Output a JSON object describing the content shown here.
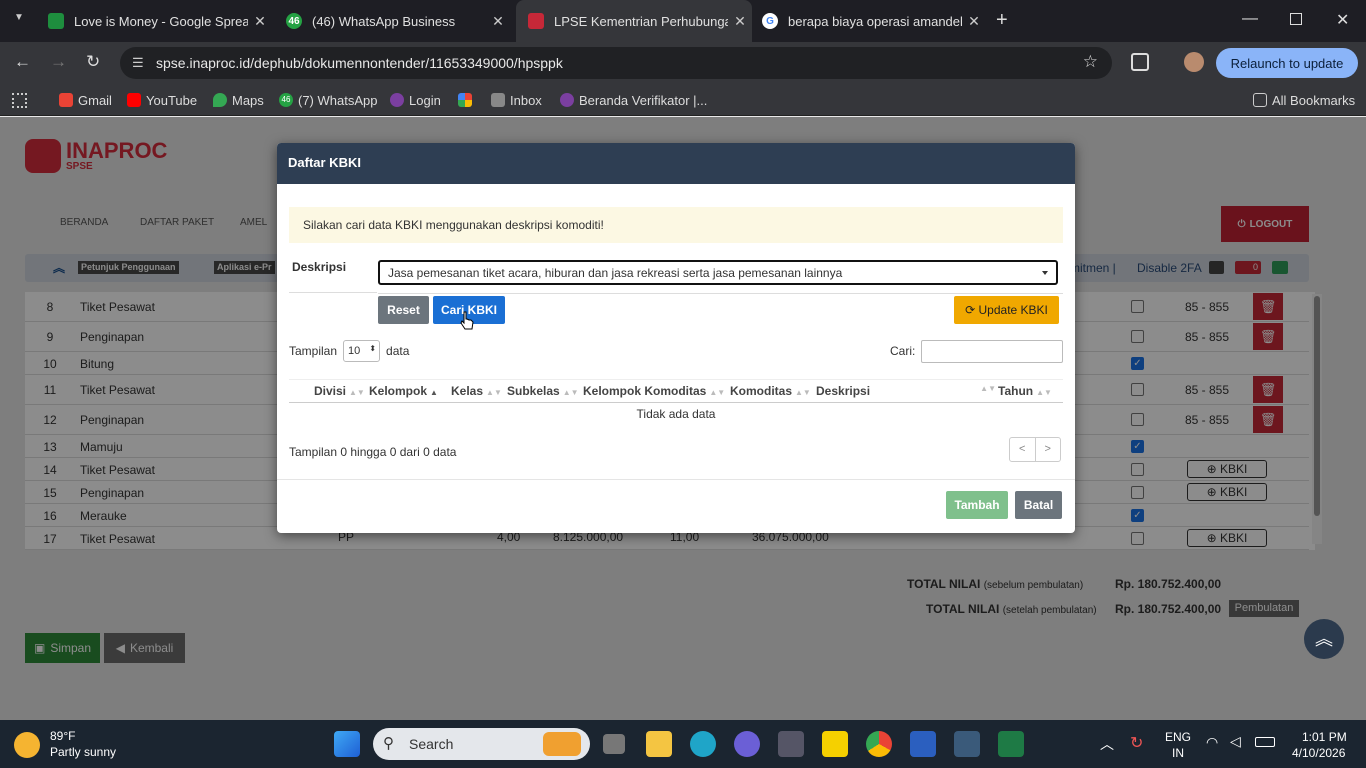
{
  "browser": {
    "tabs": [
      {
        "title": "Love is Money - Google Spread",
        "badge": ""
      },
      {
        "title": "(46) WhatsApp Business",
        "badge": "46"
      },
      {
        "title": "LPSE Kementrian Perhubungan",
        "badge": ""
      },
      {
        "title": "berapa biaya operasi amandel",
        "badge": ""
      }
    ],
    "url": "spse.inaproc.id/dephub/dokumennontender/11653349000/hpsppk",
    "relaunch": "Relaunch to update",
    "bookmarks": [
      "Gmail",
      "YouTube",
      "Maps",
      "(7) WhatsApp",
      "Login",
      "Inbox",
      "Beranda Verifikator |..."
    ],
    "whatsapp_badge": "46",
    "all_bookmarks": "All Bookmarks"
  },
  "site": {
    "logo_name": "INAPROC",
    "logo_sub": "SPSE",
    "menu": [
      "BERANDA",
      "DAFTAR PAKET",
      "AMEL"
    ],
    "logout": "LOGOUT",
    "subnav": {
      "petunjuk": "Petunjuk Penggunaan",
      "aplikasi": "Aplikasi e-Pr",
      "right_text": "mitmen |",
      "disable2fa": "Disable 2FA",
      "mail_count": "0"
    },
    "rows": [
      {
        "no": "8",
        "name": "Tiket Pesawat",
        "range": "85 - 855",
        "checked": false,
        "del": true
      },
      {
        "no": "9",
        "name": "Penginapan",
        "range": "85 - 855",
        "checked": false,
        "del": true
      },
      {
        "no": "10",
        "name": "Bitung",
        "range": "",
        "checked": true,
        "del": false
      },
      {
        "no": "11",
        "name": "Tiket Pesawat",
        "range": "85 - 855",
        "checked": false,
        "del": true
      },
      {
        "no": "12",
        "name": "Penginapan",
        "range": "85 - 855",
        "checked": false,
        "del": true
      },
      {
        "no": "13",
        "name": "Mamuju",
        "range": "",
        "checked": true,
        "del": false
      },
      {
        "no": "14",
        "name": "Tiket Pesawat",
        "range": "",
        "checked": false,
        "kbki": true
      },
      {
        "no": "15",
        "name": "Penginapan",
        "range": "",
        "checked": false,
        "kbki": true
      },
      {
        "no": "16",
        "name": "Merauke",
        "range": "",
        "checked": true,
        "del": false
      },
      {
        "no": "17",
        "name": "Tiket Pesawat",
        "range": "",
        "checked": false,
        "kbki": true
      }
    ],
    "row17_extra": {
      "unit": "PP",
      "qty": "4,00",
      "price": "8.125.000,00",
      "vol": "11,00",
      "total": "36.075.000,00"
    },
    "kbki_label": "KBKI",
    "total_before_label": "TOTAL NILAI",
    "total_before_note": "(sebelum pembulatan)",
    "total_before_value": "Rp. 180.752.400,00",
    "total_after_label": "TOTAL NILAI",
    "total_after_note": "(setelah pembulatan)",
    "total_after_value": "Rp. 180.752.400,00",
    "pembulatan": "Pembulatan",
    "simpan": "Simpan",
    "kembali": "Kembali"
  },
  "modal": {
    "title": "Daftar KBKI",
    "alert": "Silakan cari data KBKI menggunakan deskripsi komoditi!",
    "desc_label": "Deskripsi",
    "desc_value": "Jasa pemesanan tiket acara, hiburan dan jasa rekreasi serta jasa pemesanan lainnya",
    "reset": "Reset",
    "cari_kbki": "Cari KBKI",
    "update_kbki": "Update KBKI",
    "tampilan": "Tampilan",
    "page_size": "10",
    "data": "data",
    "cari": "Cari:",
    "columns": [
      "Divisi",
      "Kelompok",
      "Kelas",
      "Subkelas",
      "Kelompok Komoditas",
      "Komoditas",
      "Deskripsi",
      "Tahun"
    ],
    "empty": "Tidak ada data",
    "info": "Tampilan 0 hingga 0 dari 0 data",
    "prev": "<",
    "next": ">",
    "tambah": "Tambah",
    "batal": "Batal"
  },
  "taskbar": {
    "weather_temp": "89°F",
    "weather_desc": "Partly sunny",
    "search": "Search",
    "lang1": "ENG",
    "lang2": "IN",
    "time": "1:01 PM",
    "date": "4/10/2026"
  }
}
